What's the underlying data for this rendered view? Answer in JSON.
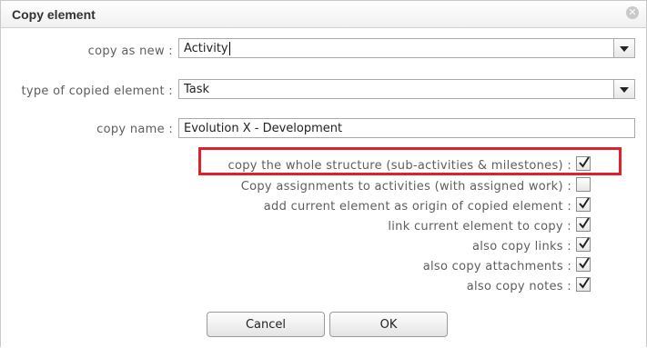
{
  "dialog": {
    "title": "Copy element",
    "close_icon": "close-icon"
  },
  "form": {
    "copy_as_new": {
      "label": "copy as new :",
      "value": "Activity"
    },
    "type_of_copied": {
      "label": "type of copied element :",
      "value": "Task"
    },
    "copy_name": {
      "label": "copy name :",
      "value": "Evolution X - Development"
    }
  },
  "options": [
    {
      "label": "copy the whole structure (sub-activities & milestones) :",
      "checked": true,
      "highlighted": true
    },
    {
      "label": "Copy assignments to activities (with assigned work) :",
      "checked": false
    },
    {
      "label": "add current element as origin of copied element :",
      "checked": true
    },
    {
      "label": "link current element to copy :",
      "checked": true
    },
    {
      "label": "also copy links :",
      "checked": true
    },
    {
      "label": "also copy attachments :",
      "checked": true
    },
    {
      "label": "also copy notes :",
      "checked": true
    }
  ],
  "buttons": {
    "cancel": "Cancel",
    "ok": "OK"
  },
  "colors": {
    "highlight": "#e0202a"
  }
}
